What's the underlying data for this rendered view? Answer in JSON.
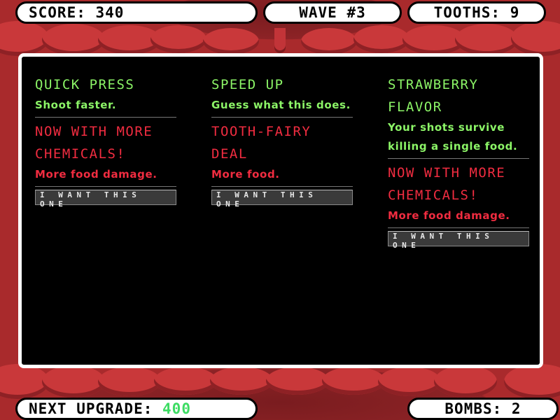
{
  "hud": {
    "score_label": "SCORE:",
    "score_value": "340",
    "wave_label": "WAVE #3",
    "tooths_label": "TOOTHS:",
    "tooths_value": "9",
    "next_upgrade_label": "NEXT UPGRADE:",
    "next_upgrade_value": "400",
    "bombs_label": "BOMBS:",
    "bombs_value": "2"
  },
  "colors": {
    "good_upgrade": "#8cf567",
    "bad_upgrade": "#f02c40",
    "next_upgrade_value": "#3ddc63"
  },
  "choices": [
    {
      "upgrades": [
        {
          "kind": "good",
          "title": "QUICK PRESS",
          "desc": "Shoot faster."
        },
        {
          "kind": "bad",
          "title": "NOW WITH MORE CHEMICALS!",
          "desc": "More food damage."
        }
      ],
      "button_label": "I WANT THIS ONE"
    },
    {
      "upgrades": [
        {
          "kind": "good",
          "title": "SPEED UP",
          "desc": "Guess what this does."
        },
        {
          "kind": "bad",
          "title": "TOOTH-FAIRY DEAL",
          "desc": "More food."
        }
      ],
      "button_label": "I WANT THIS ONE"
    },
    {
      "upgrades": [
        {
          "kind": "good",
          "title": "STRAWBERRY FLAVOR",
          "desc": "Your shots survive killing a single food."
        },
        {
          "kind": "bad",
          "title": "NOW WITH MORE CHEMICALS!",
          "desc": "More food damage."
        }
      ],
      "button_label": "I WANT THIS ONE"
    }
  ]
}
